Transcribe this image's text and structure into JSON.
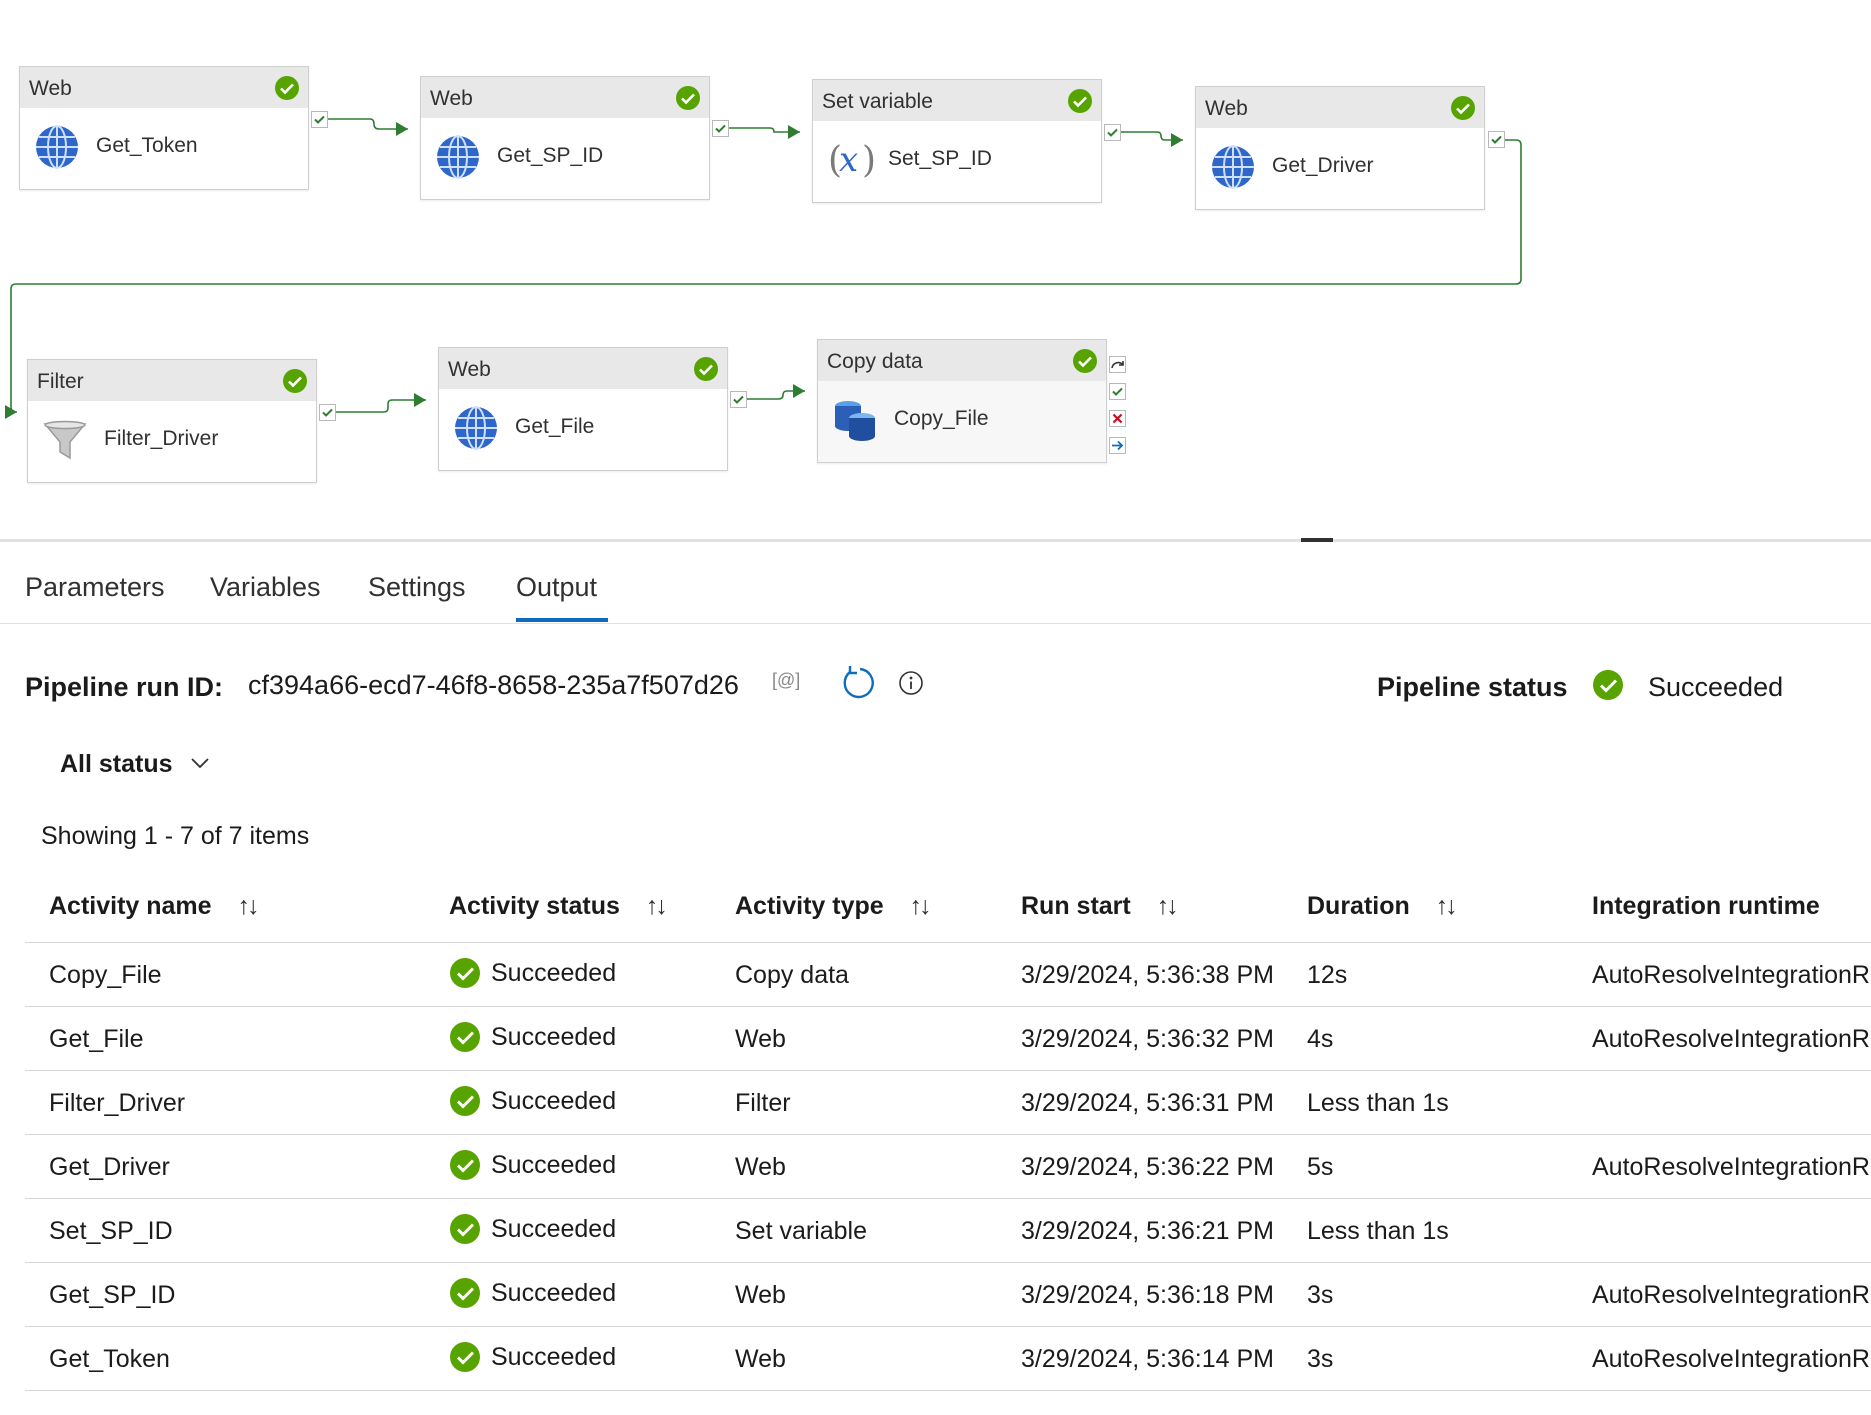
{
  "nodes": [
    {
      "type": "Web",
      "name": "Get_Token",
      "icon": "globe-icon"
    },
    {
      "type": "Web",
      "name": "Get_SP_ID",
      "icon": "globe-icon"
    },
    {
      "type": "Set variable",
      "name": "Set_SP_ID",
      "icon": "variable-icon"
    },
    {
      "type": "Web",
      "name": "Get_Driver",
      "icon": "globe-icon"
    },
    {
      "type": "Filter",
      "name": "Filter_Driver",
      "icon": "funnel-icon"
    },
    {
      "type": "Web",
      "name": "Get_File",
      "icon": "globe-icon"
    },
    {
      "type": "Copy data",
      "name": "Copy_File",
      "icon": "database-icon"
    }
  ],
  "tabs": [
    "Parameters",
    "Variables",
    "Settings",
    "Output"
  ],
  "active_tab": "Output",
  "run": {
    "id_label": "Pipeline run ID:",
    "id_value": "cf394a66-ecd7-46f8-8658-235a7f507d26",
    "copy_glyph": "[@]",
    "status_label": "Pipeline status",
    "status_value": "Succeeded"
  },
  "filter_label": "All status",
  "showing": "Showing 1 - 7 of 7 items",
  "columns": [
    "Activity name",
    "Activity status",
    "Activity type",
    "Run start",
    "Duration",
    "Integration runtime"
  ],
  "rows": [
    {
      "name": "Copy_File",
      "status": "Succeeded",
      "type": "Copy data",
      "start": "3/29/2024, 5:36:38 PM",
      "duration": "12s",
      "runtime": "AutoResolveIntegrationRuntime"
    },
    {
      "name": "Get_File",
      "status": "Succeeded",
      "type": "Web",
      "start": "3/29/2024, 5:36:32 PM",
      "duration": "4s",
      "runtime": "AutoResolveIntegrationRuntime"
    },
    {
      "name": "Filter_Driver",
      "status": "Succeeded",
      "type": "Filter",
      "start": "3/29/2024, 5:36:31 PM",
      "duration": "Less than 1s",
      "runtime": ""
    },
    {
      "name": "Get_Driver",
      "status": "Succeeded",
      "type": "Web",
      "start": "3/29/2024, 5:36:22 PM",
      "duration": "5s",
      "runtime": "AutoResolveIntegrationRuntime"
    },
    {
      "name": "Set_SP_ID",
      "status": "Succeeded",
      "type": "Set variable",
      "start": "3/29/2024, 5:36:21 PM",
      "duration": "Less than 1s",
      "runtime": ""
    },
    {
      "name": "Get_SP_ID",
      "status": "Succeeded",
      "type": "Web",
      "start": "3/29/2024, 5:36:18 PM",
      "duration": "3s",
      "runtime": "AutoResolveIntegrationRuntime"
    },
    {
      "name": "Get_Token",
      "status": "Succeeded",
      "type": "Web",
      "start": "3/29/2024, 5:36:14 PM",
      "duration": "3s",
      "runtime": "AutoResolveIntegrationRuntime"
    }
  ],
  "colors": {
    "success": "#57a300",
    "wire": "#2f7d32",
    "accent": "#0f6cbd",
    "error": "#c50f1f"
  }
}
